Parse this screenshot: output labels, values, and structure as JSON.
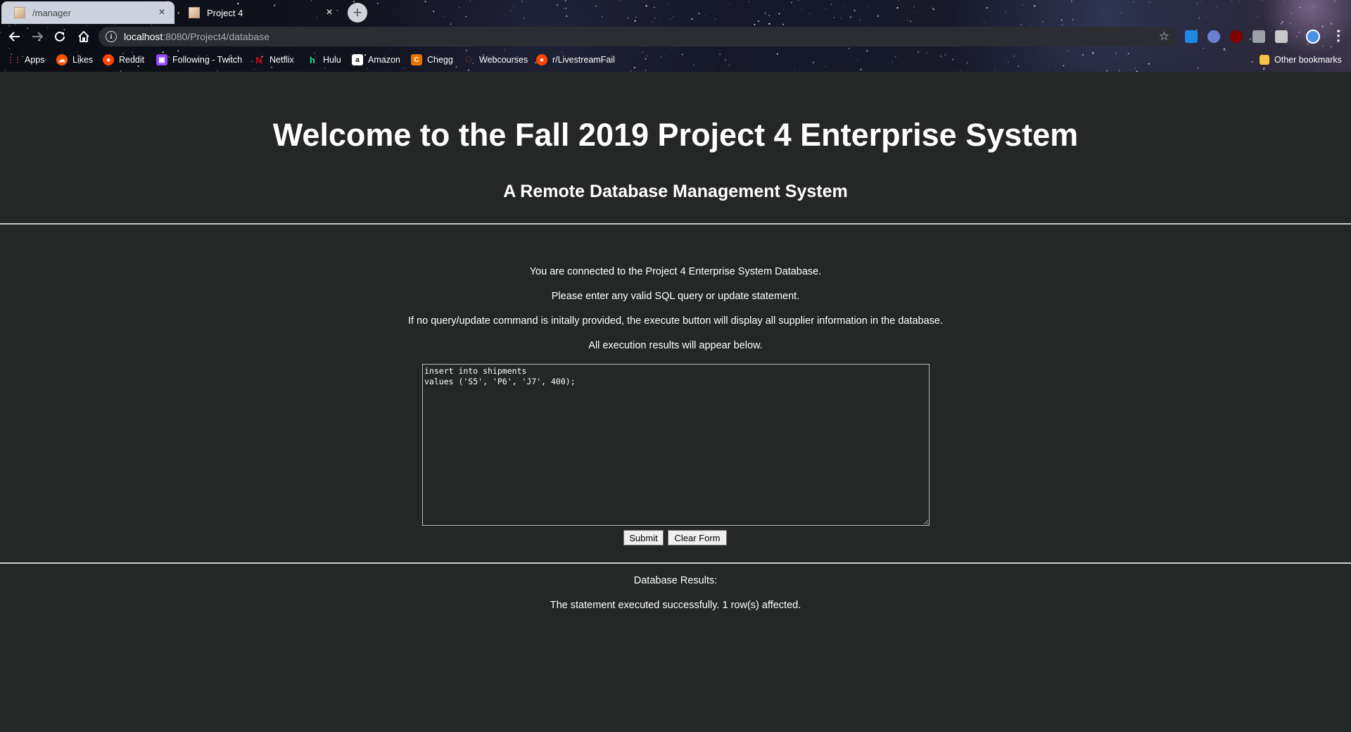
{
  "browser": {
    "tabs": [
      {
        "title": "/manager",
        "active": false
      },
      {
        "title": "Project 4",
        "active": true
      }
    ],
    "new_tab_glyph": "+",
    "address": {
      "host": "localhost",
      "rest": ":8080/Project4/database"
    },
    "bookmarks": [
      {
        "label": "Apps",
        "icon": "apps-grid-icon",
        "color": "#e8453c"
      },
      {
        "label": "Likes",
        "icon": "soundcloud-icon",
        "color": "#ff5500"
      },
      {
        "label": "Reddit",
        "icon": "reddit-icon",
        "color": "#ff4500"
      },
      {
        "label": "Following - Twitch",
        "icon": "twitch-icon",
        "color": "#9146ff"
      },
      {
        "label": "Netflix",
        "icon": "netflix-icon",
        "color": "#e50914"
      },
      {
        "label": "Hulu",
        "icon": "hulu-icon",
        "color": "#1ce783"
      },
      {
        "label": "Amazon",
        "icon": "amazon-icon",
        "color": "#ffffff"
      },
      {
        "label": "Chegg",
        "icon": "chegg-icon",
        "color": "#eb7100"
      },
      {
        "label": "Webcourses",
        "icon": "webcourses-icon",
        "color": "#e03a3e"
      },
      {
        "label": "r/LivestreamFail",
        "icon": "reddit-icon",
        "color": "#ff4500"
      }
    ],
    "other_bookmarks": "Other bookmarks"
  },
  "page": {
    "title": "Welcome to the Fall 2019 Project 4 Enterprise System",
    "subtitle": "A Remote Database Management System",
    "instructions": [
      "You are connected to the Project 4 Enterprise System Database.",
      "Please enter any valid SQL query or update statement.",
      "If no query/update command is initally provided, the execute button will display all supplier information in the database.",
      "All execution results will appear below."
    ],
    "sql_text": "insert into shipments\nvalues ('S5', 'P6', 'J7', 400);",
    "submit_label": "Submit",
    "clear_label": "Clear Form",
    "results_heading": "Database Results:",
    "results_message": "The statement executed successfully. 1 row(s) affected."
  },
  "colors": {
    "page_background": "#252727",
    "text": "#ffffff",
    "rule": "#c9c9c9"
  }
}
